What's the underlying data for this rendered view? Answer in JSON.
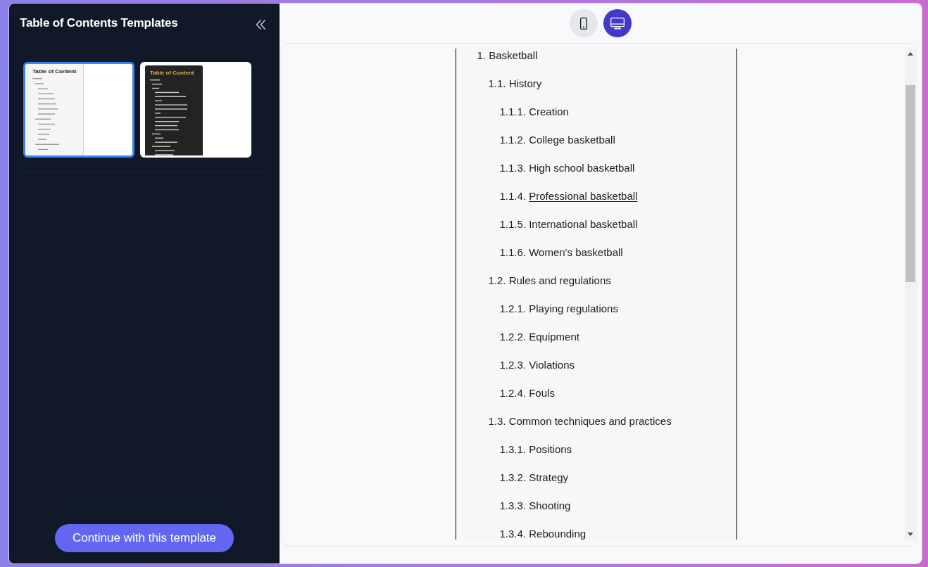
{
  "sidebar": {
    "title": "Table of Contents Templates",
    "templates": [
      {
        "kind": "light",
        "heading": "Table of Content",
        "selected": true
      },
      {
        "kind": "dark",
        "heading": "Table of Content",
        "selected": false
      }
    ],
    "primary_button": "Continue with this template"
  },
  "view_toggle": [
    {
      "kind": "mobile",
      "selected": false
    },
    {
      "kind": "desktop",
      "selected": true
    }
  ],
  "toc": [
    {
      "number": "1.",
      "title": "Basketball",
      "hovered": false,
      "children": [
        {
          "number": "1.1.",
          "title": "History",
          "hovered": false,
          "children": [
            {
              "number": "1.1.1.",
              "title": "Creation",
              "hovered": false
            },
            {
              "number": "1.1.2.",
              "title": "College basketball",
              "hovered": false
            },
            {
              "number": "1.1.3.",
              "title": "High school basketball",
              "hovered": false
            },
            {
              "number": "1.1.4.",
              "title": "Professional basketball",
              "hovered": true
            },
            {
              "number": "1.1.5.",
              "title": "International basketball",
              "hovered": false
            },
            {
              "number": "1.1.6.",
              "title": "Women's basketball",
              "hovered": false
            }
          ]
        },
        {
          "number": "1.2.",
          "title": "Rules and regulations",
          "hovered": false,
          "children": [
            {
              "number": "1.2.1.",
              "title": "Playing regulations",
              "hovered": false
            },
            {
              "number": "1.2.2.",
              "title": "Equipment",
              "hovered": false
            },
            {
              "number": "1.2.3.",
              "title": "Violations",
              "hovered": false
            },
            {
              "number": "1.2.4.",
              "title": "Fouls",
              "hovered": false
            }
          ]
        },
        {
          "number": "1.3.",
          "title": "Common techniques and practices",
          "hovered": false,
          "children": [
            {
              "number": "1.3.1.",
              "title": "Positions",
              "hovered": false
            },
            {
              "number": "1.3.2.",
              "title": "Strategy",
              "hovered": false
            },
            {
              "number": "1.3.3.",
              "title": "Shooting",
              "hovered": false
            },
            {
              "number": "1.3.4.",
              "title": "Rebounding",
              "hovered": false
            }
          ]
        }
      ]
    }
  ]
}
